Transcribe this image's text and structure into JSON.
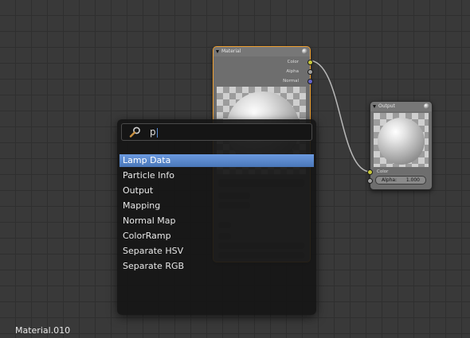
{
  "material_node": {
    "title": "Material",
    "outputs": [
      {
        "label": "Color",
        "color": "#c8c83c"
      },
      {
        "label": "Alpha",
        "color": "#a0a0a0"
      },
      {
        "label": "Normal",
        "color": "#6464c8"
      }
    ]
  },
  "output_node": {
    "title": "Output",
    "inputs": [
      {
        "label": "Color",
        "color": "#c8c83c"
      }
    ],
    "alpha_label": "Alpha:",
    "alpha_value": "1.000"
  },
  "search": {
    "query": "p",
    "icon": "magnifier-icon"
  },
  "menu": {
    "items": [
      {
        "label": "Lamp Data",
        "selected": true
      },
      {
        "label": "Particle Info",
        "selected": false
      },
      {
        "label": "Output",
        "selected": false
      },
      {
        "label": "Mapping",
        "selected": false
      },
      {
        "label": "Normal Map",
        "selected": false
      },
      {
        "label": "ColorRamp",
        "selected": false
      },
      {
        "label": "Separate HSV",
        "selected": false
      },
      {
        "label": "Separate RGB",
        "selected": false
      }
    ]
  },
  "footer": {
    "material_name": "Material.010"
  },
  "colors": {
    "accent": "#5680c2",
    "node_select_border": "#f0a030",
    "background": "#393939"
  }
}
